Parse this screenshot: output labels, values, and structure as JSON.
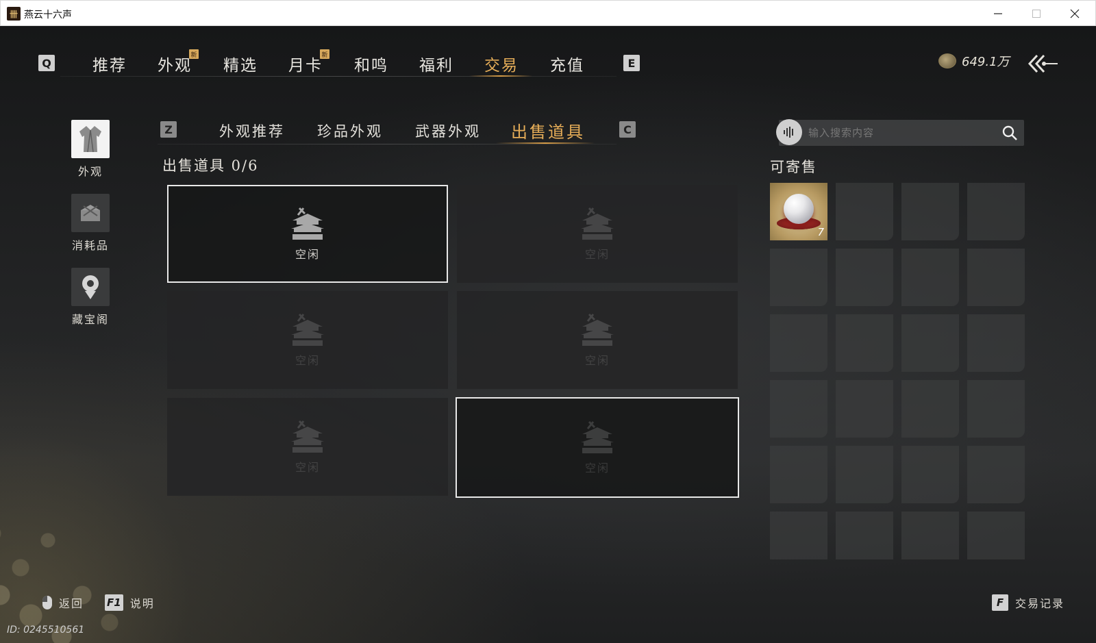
{
  "window": {
    "title": "燕云十六声",
    "minimize_icon": "minimize-icon",
    "maximize_icon": "maximize-icon",
    "close_icon": "close-icon"
  },
  "top_nav": {
    "left_key": "Q",
    "right_key": "E",
    "tabs": [
      {
        "label": "推荐",
        "new": false
      },
      {
        "label": "外观",
        "new": true
      },
      {
        "label": "精选",
        "new": false
      },
      {
        "label": "月卡",
        "new": true
      },
      {
        "label": "和鸣",
        "new": false
      },
      {
        "label": "福利",
        "new": false
      },
      {
        "label": "交易",
        "new": false,
        "active": true
      },
      {
        "label": "充值",
        "new": false
      }
    ],
    "new_badge": "新",
    "currency_value": "649.1万",
    "currency_icon": "coin-pouch-icon",
    "back_icon": "back-arrow-icon"
  },
  "sidebar": {
    "items": [
      {
        "label": "外观",
        "icon": "robe-icon",
        "active": true
      },
      {
        "label": "消耗品",
        "icon": "package-icon",
        "active": false
      },
      {
        "label": "藏宝阁",
        "icon": "treasure-icon",
        "active": false
      }
    ]
  },
  "sub_nav": {
    "left_key": "Z",
    "right_key": "C",
    "tabs": [
      {
        "label": "外观推荐",
        "active": false
      },
      {
        "label": "珍品外观",
        "active": false
      },
      {
        "label": "武器外观",
        "active": false
      },
      {
        "label": "出售道具",
        "active": true
      }
    ]
  },
  "sell_section": {
    "title": "出售道具 0/6",
    "slots": [
      {
        "label": "空闲",
        "icon": "pavilion-icon"
      },
      {
        "label": "空闲",
        "icon": "pavilion-icon"
      },
      {
        "label": "空闲",
        "icon": "pavilion-icon"
      },
      {
        "label": "空闲",
        "icon": "pavilion-icon"
      },
      {
        "label": "空闲",
        "icon": "pavilion-icon"
      },
      {
        "label": "空闲",
        "icon": "pavilion-icon"
      }
    ]
  },
  "consign_panel": {
    "search_placeholder": "输入搜索内容",
    "voice_icon": "voice-icon",
    "search_icon": "search-icon",
    "title": "可寄售",
    "items": [
      {
        "name": "pearl",
        "icon": "pearl-icon",
        "count": "7"
      }
    ]
  },
  "bottom_bar": {
    "back_label": "返回",
    "help_key": "F1",
    "help_label": "说明",
    "records_key": "F",
    "records_label": "交易记录"
  },
  "user_id": "ID: 0245510561",
  "colors": {
    "accent": "#e5ad58",
    "text": "#e6e3dc",
    "background": "#1b1c1d"
  }
}
